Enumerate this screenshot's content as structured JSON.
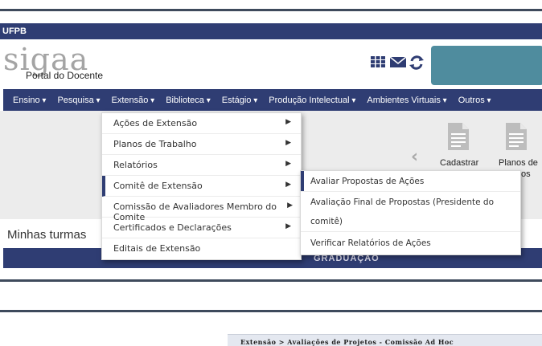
{
  "header": {
    "institution": "UFPB",
    "logo_text": "sigaa",
    "logo_subtitle": "Portal do Docente"
  },
  "menu": {
    "items": [
      {
        "label": "Ensino"
      },
      {
        "label": "Pesquisa"
      },
      {
        "label": "Extensão"
      },
      {
        "label": "Biblioteca"
      },
      {
        "label": "Estágio"
      },
      {
        "label": "Produção Intelectual"
      },
      {
        "label": "Ambientes Virtuais"
      },
      {
        "label": "Outros"
      }
    ]
  },
  "extensao_dropdown": {
    "items": [
      {
        "label": "Ações de Extensão",
        "has_submenu": true
      },
      {
        "label": "Planos de Trabalho",
        "has_submenu": true
      },
      {
        "label": "Relatórios",
        "has_submenu": true
      },
      {
        "label": "Comitê de Extensão",
        "has_submenu": true,
        "active": true
      },
      {
        "label": "Comissão de Avaliadores Membro do Comite",
        "has_submenu": true
      },
      {
        "label": "Certificados e Declarações",
        "has_submenu": true
      },
      {
        "label": "Editais de Extensão",
        "has_submenu": false
      }
    ]
  },
  "comite_submenu": {
    "items": [
      {
        "label": "Avaliar Propostas de Ações"
      },
      {
        "label": "Avaliação Final de Propostas (Presidente do"
      },
      {
        "label": "comitê)"
      },
      {
        "label": "Verificar Relatórios de Ações"
      }
    ]
  },
  "tiles": {
    "cadastrar": "Cadastrar",
    "planos_line1": "Planos de",
    "planos_line2": "os"
  },
  "section": {
    "minhas_turmas": "Minhas turmas",
    "graduacao": "GRADUAÇÃO"
  },
  "breadcrumb": "Extensão > Avaliações de Projetos - Comissão Ad Hoc",
  "colors": {
    "navy": "#2f3d73",
    "teal": "#4f8c9e"
  }
}
